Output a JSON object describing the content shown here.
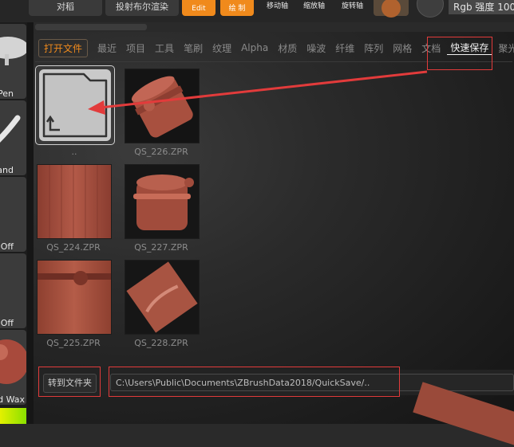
{
  "toolbar": {
    "btn_left": "对稻",
    "btn_mid": "投射布尔渲染",
    "edit_label": "Edit",
    "draw_label": "绘 制",
    "move_label": "移动轴",
    "scale_label": "缩放轴",
    "rotate_label": "旋转轴",
    "rgb_label": "Rgb 强度 100"
  },
  "left_panel": {
    "items": [
      {
        "label": "Pen"
      },
      {
        "label": "and"
      },
      {
        "label": "Off"
      },
      {
        "label": "Off"
      },
      {
        "label": "ed Wax"
      }
    ]
  },
  "tabs": [
    {
      "label": "打开文件"
    },
    {
      "label": "最近"
    },
    {
      "label": "项目"
    },
    {
      "label": "工具"
    },
    {
      "label": "笔刷"
    },
    {
      "label": "纹理"
    },
    {
      "label": "Alpha"
    },
    {
      "label": "材质"
    },
    {
      "label": "噪波"
    },
    {
      "label": "纤维"
    },
    {
      "label": "阵列"
    },
    {
      "label": "网格"
    },
    {
      "label": "文档"
    },
    {
      "label": "快速保存"
    },
    {
      "label": "聚光"
    }
  ],
  "files": [
    {
      "name": ".."
    },
    {
      "name": "QS_226.ZPR"
    },
    {
      "name": "QS_224.ZPR"
    },
    {
      "name": "QS_227.ZPR"
    },
    {
      "name": "QS_225.ZPR"
    },
    {
      "name": "QS_228.ZPR"
    }
  ],
  "bottom": {
    "goto_label": "转到文件夹",
    "path": "C:\\Users\\Public\\Documents\\ZBrushData2018/QuickSave/.."
  },
  "colors": {
    "accent": "#f08a1c",
    "annotation": "#e23b3b",
    "clay": "#a8503f"
  }
}
